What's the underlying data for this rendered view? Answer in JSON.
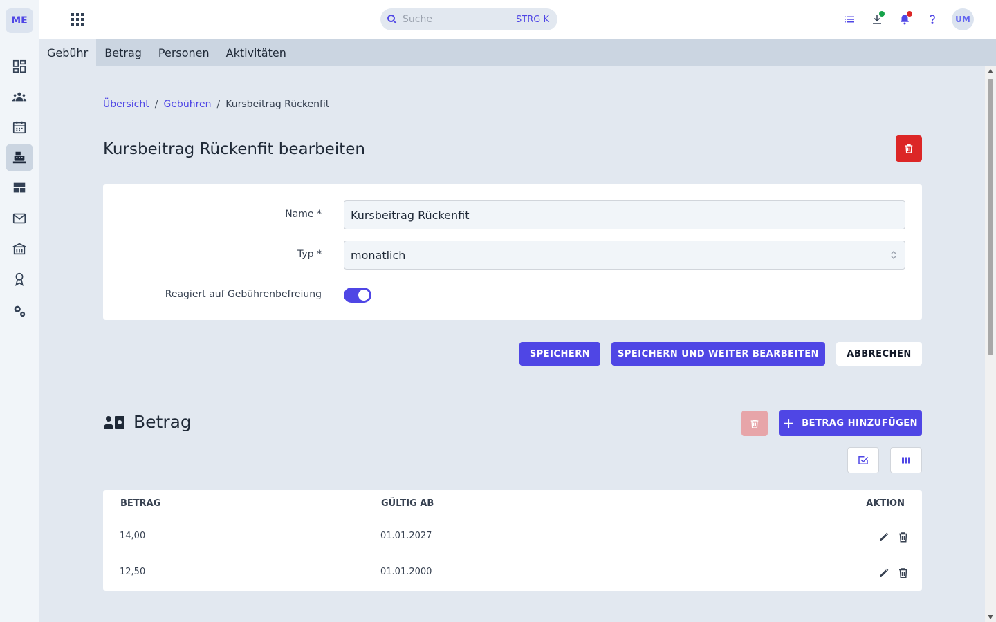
{
  "app": {
    "logo": "ME",
    "user_initials": "UM"
  },
  "sidebar": {
    "items": [
      {
        "icon": "dashboard-icon"
      },
      {
        "icon": "people-icon"
      },
      {
        "icon": "calendar-icon"
      },
      {
        "icon": "cash-register-icon",
        "active": true
      },
      {
        "icon": "table-icon"
      },
      {
        "icon": "mail-icon"
      },
      {
        "icon": "building-icon"
      },
      {
        "icon": "award-icon"
      },
      {
        "icon": "settings-icon"
      }
    ]
  },
  "topbar": {
    "search_placeholder": "Suche",
    "search_shortcut": "STRG K"
  },
  "tabs": [
    {
      "label": "Gebühr",
      "active": true
    },
    {
      "label": "Betrag"
    },
    {
      "label": "Personen"
    },
    {
      "label": "Aktivitäten"
    }
  ],
  "breadcrumb": {
    "items": [
      "Übersicht",
      "Gebühren"
    ],
    "current": "Kursbeitrag Rückenfit",
    "separator": "/"
  },
  "page": {
    "title": "Kursbeitrag Rückenfit bearbeiten"
  },
  "form": {
    "name_label": "Name *",
    "name_value": "Kursbeitrag Rückenfit",
    "type_label": "Typ *",
    "type_value": "monatlich",
    "exemption_label": "Reagiert auf Gebührenbefreiung",
    "exemption_enabled": true
  },
  "actions": {
    "save": "SPEICHERN",
    "save_continue": "SPEICHERN UND WEITER BEARBEITEN",
    "cancel": "ABBRECHEN"
  },
  "amount_section": {
    "title": "Betrag",
    "add_label": "BETRAG HINZUFÜGEN",
    "columns": [
      "BETRAG",
      "GÜLTIG AB",
      "AKTION"
    ],
    "rows": [
      {
        "amount": "14,00",
        "valid_from": "01.01.2027"
      },
      {
        "amount": "12,50",
        "valid_from": "01.01.2000"
      }
    ]
  },
  "colors": {
    "accent": "#4f46e5",
    "danger": "#dc2626",
    "danger_disabled": "#e7a5a9",
    "background": "#e2e8f0"
  }
}
